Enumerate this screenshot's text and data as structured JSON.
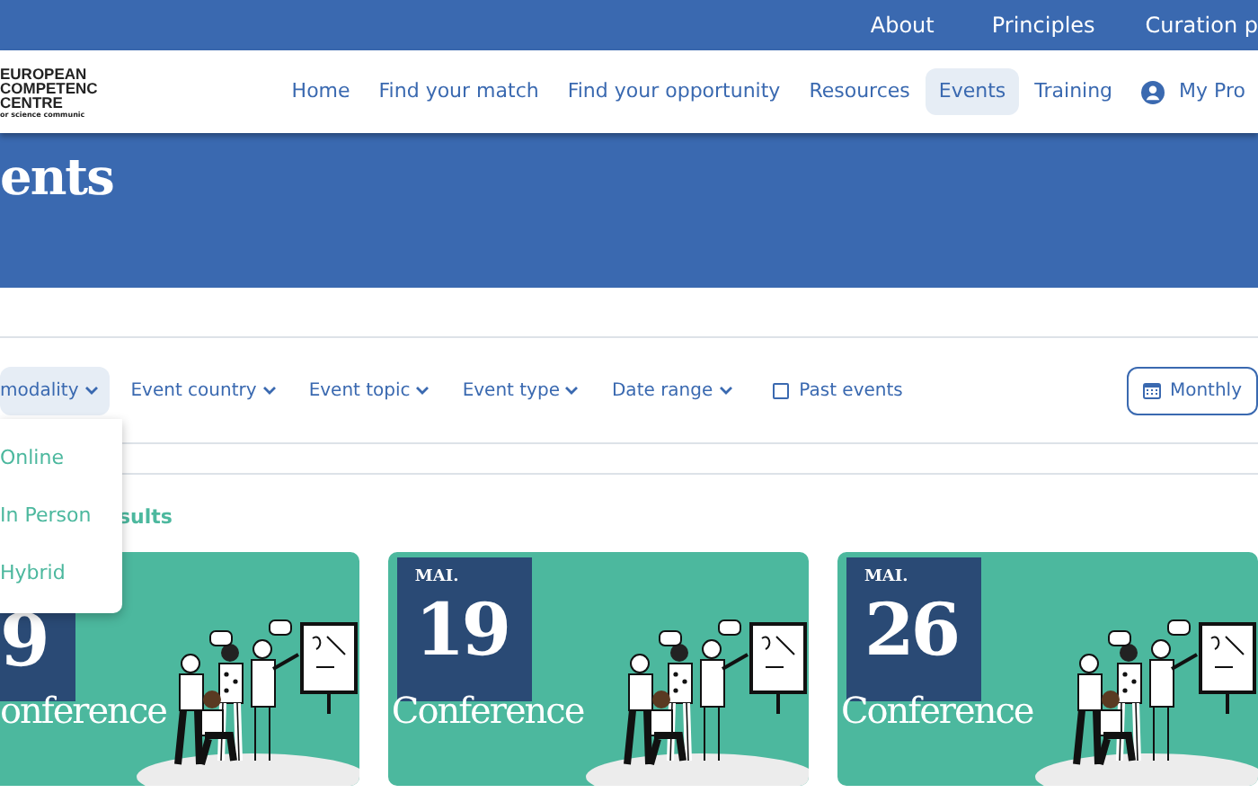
{
  "top_links": [
    "About",
    "Principles",
    "Curation p"
  ],
  "logo": {
    "lines": [
      "EUROPEAN",
      "COMPETENC",
      "CENTRE",
      "or science communic"
    ]
  },
  "nav": {
    "items": [
      {
        "label": "Home",
        "selected": false
      },
      {
        "label": "Find your match",
        "selected": false
      },
      {
        "label": "Find your opportunity",
        "selected": false
      },
      {
        "label": "Resources",
        "selected": false
      },
      {
        "label": "Events",
        "selected": true
      },
      {
        "label": "Training",
        "selected": false
      }
    ],
    "profile": "My Pro"
  },
  "hero": {
    "title": "ents"
  },
  "filters": [
    {
      "label": "modality",
      "kind": "dropdown",
      "expanded": true
    },
    {
      "label": "Event country",
      "kind": "dropdown",
      "expanded": false
    },
    {
      "label": "Event topic",
      "kind": "dropdown",
      "expanded": false
    },
    {
      "label": "Event type",
      "kind": "dropdown",
      "expanded": false
    },
    {
      "label": "Date range",
      "kind": "dropdown",
      "expanded": false
    },
    {
      "label": "Past events",
      "kind": "checkbox",
      "checked": false
    }
  ],
  "view_button": "Monthly",
  "dropdown_options": [
    "Online",
    "In Person",
    "Hybrid"
  ],
  "results_label": "sults",
  "cards": [
    {
      "day": "9",
      "type": "onference"
    },
    {
      "month": "MAI.",
      "day": "19",
      "type": "Conference"
    },
    {
      "month": "MAI.",
      "day": "26",
      "type": "Conference"
    }
  ]
}
